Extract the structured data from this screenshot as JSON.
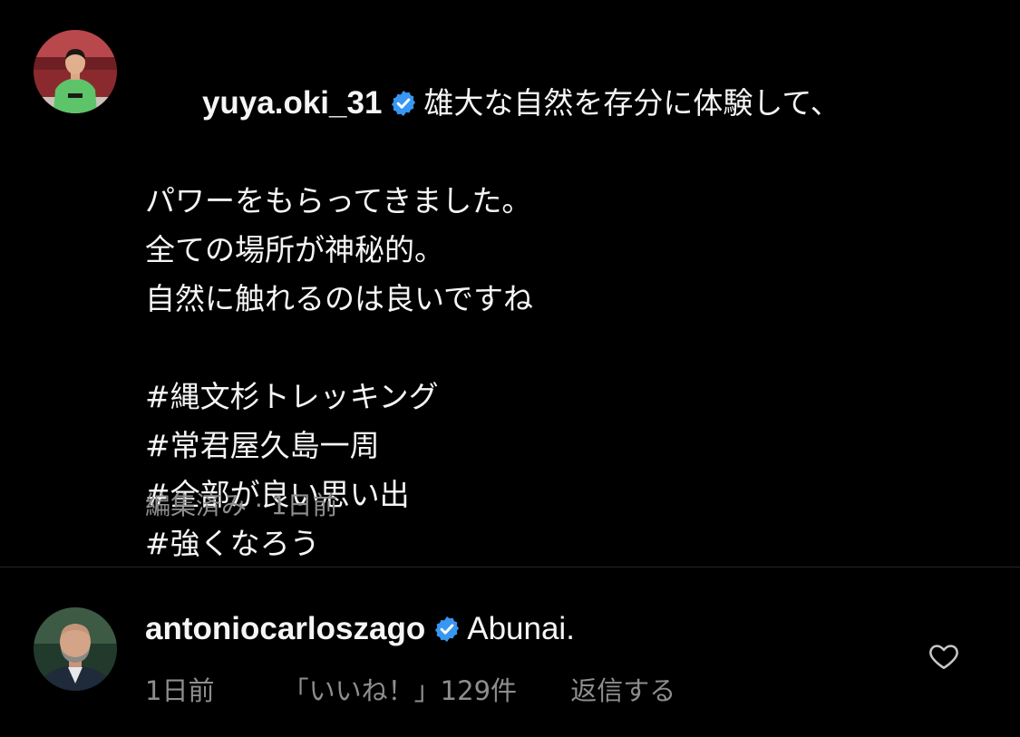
{
  "post": {
    "username": "yuya.oki_31",
    "caption_first": "雄大な自然を存分に体験して、",
    "caption_lines": [
      "パワーをもらってきました。",
      "全ての場所が神秘的。",
      "自然に触れるのは良いですね"
    ],
    "hashtags": [
      "#縄文杉トレッキング",
      "#常君屋久島一周",
      "#全部が良い思い出",
      "#強くなろう"
    ],
    "meta": "編集済み · 1日前"
  },
  "comment": {
    "username": "antoniocarloszago",
    "text": "Abunai.",
    "time": "1日前",
    "likes": "「いいね！」129件",
    "reply": "返信する"
  },
  "icons": {
    "verified": "verified-badge-icon",
    "heart": "heart-outline-icon"
  },
  "colors": {
    "background": "#000000",
    "text": "#f5f5f5",
    "secondary": "#8e8e8e",
    "verified": "#3897f0",
    "divider": "#262626"
  }
}
